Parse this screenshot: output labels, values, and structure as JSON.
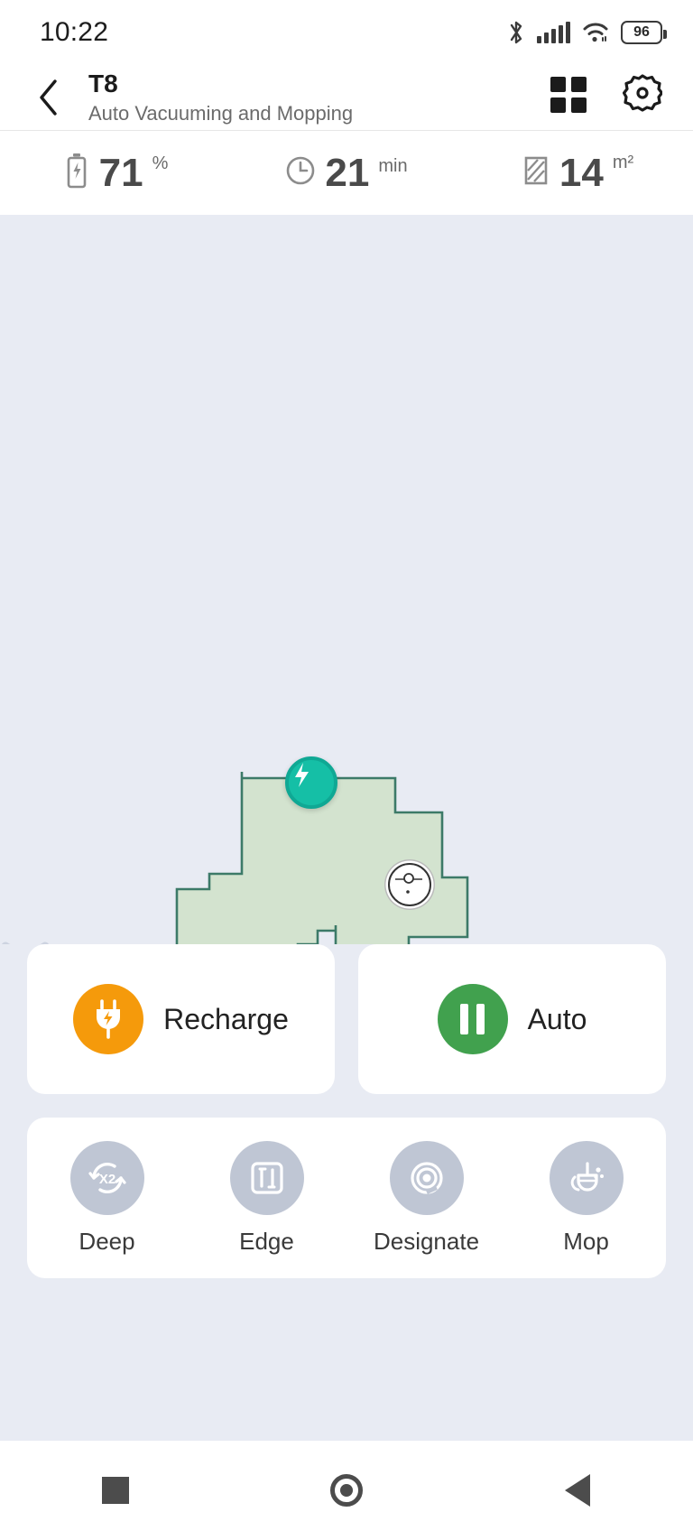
{
  "statusbar": {
    "time": "10:22",
    "battery_level": "96",
    "icons": [
      "bluetooth-icon",
      "cellular-signal-icon",
      "wifi-icon",
      "battery-icon"
    ]
  },
  "header": {
    "back_icon": "chevron-left-icon",
    "title": "T8",
    "subtitle": "Auto Vacuuming and Mopping",
    "grid_icon": "grid-view-icon",
    "settings_icon": "gear-icon"
  },
  "stats": [
    {
      "icon": "battery-charging-icon",
      "value": "71",
      "unit": "%",
      "name": "battery-stat"
    },
    {
      "icon": "clock-icon",
      "value": "21",
      "unit": "min",
      "name": "time-stat"
    },
    {
      "icon": "area-icon",
      "value": "14",
      "unit": "m²",
      "name": "area-stat"
    }
  ],
  "map": {
    "dock_icon": "charging-dock-icon",
    "robot_icon": "robot-vacuum-icon",
    "locate_icon": "locate-target-icon",
    "more_icon": "more-options-icon",
    "collapse_icon": "chevron-down-icon",
    "colors": {
      "floor_fill": "#d3e3cf",
      "floor_stroke": "#3c7a68",
      "background": "#e8ebf3",
      "dock_green": "#15bfa6"
    }
  },
  "actions": [
    {
      "label": "Recharge",
      "icon": "plug-charge-icon",
      "color": "#f59a0b",
      "name": "recharge-button"
    },
    {
      "label": "Auto",
      "icon": "pause-icon",
      "color": "#41a14e",
      "name": "auto-button"
    }
  ],
  "modes": [
    {
      "label": "Deep",
      "icon": "x2-repeat-icon",
      "name": "mode-deep"
    },
    {
      "label": "Edge",
      "icon": "edge-square-icon",
      "name": "mode-edge"
    },
    {
      "label": "Designate",
      "icon": "spiral-target-icon",
      "name": "mode-designate"
    },
    {
      "label": "Mop",
      "icon": "mop-broom-icon",
      "name": "mode-mop"
    }
  ],
  "navbar": [
    {
      "icon": "recents-square-icon",
      "name": "nav-recents"
    },
    {
      "icon": "home-circle-icon",
      "name": "nav-home"
    },
    {
      "icon": "back-triangle-icon",
      "name": "nav-back"
    }
  ]
}
